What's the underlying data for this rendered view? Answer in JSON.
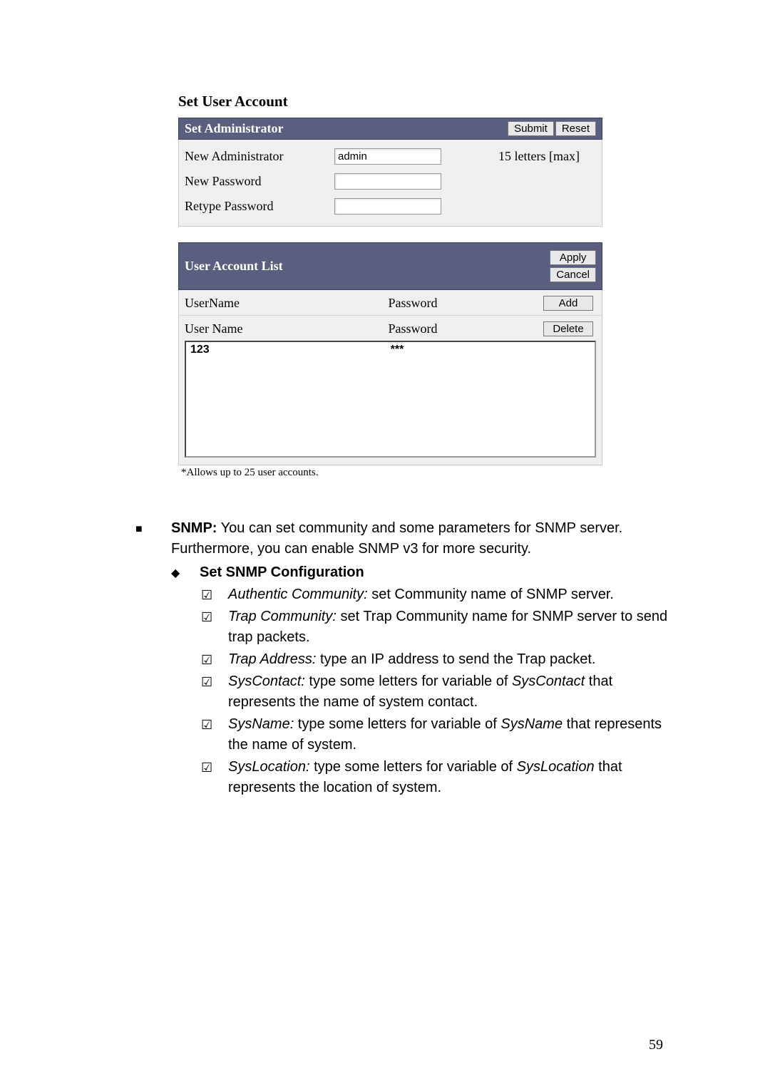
{
  "screenshot": {
    "title": "Set User Account",
    "admin_panel": {
      "header": "Set Administrator",
      "submit": "Submit",
      "reset": "Reset",
      "rows": {
        "new_admin_label": "New Administrator",
        "new_admin_value": "admin",
        "new_admin_hint": "15 letters [max]",
        "new_pw_label": "New Password",
        "retype_pw_label": "Retype Password"
      }
    },
    "user_panel": {
      "header": "User Account List",
      "apply": "Apply",
      "cancel": "Cancel",
      "username_label": "UserName",
      "password_label": "Password",
      "add": "Add",
      "col_user": "User Name",
      "col_pw": "Password",
      "delete": "Delete",
      "list_row_user": "123",
      "list_row_pw": "***",
      "footnote": "*Allows up to 25 user accounts."
    }
  },
  "content": {
    "snmp_label": "SNMP:",
    "snmp_text": " You can set community and some parameters for SNMP server. Furthermore, you can enable SNMP v3 for more security.",
    "set_snmp": "Set SNMP Configuration",
    "items": [
      {
        "term": "Authentic Community:",
        "desc": " set Community name of SNMP server."
      },
      {
        "term": "Trap Community:",
        "desc": " set Trap Community name for SNMP server to send trap packets."
      },
      {
        "term": "Trap Address:",
        "desc": " type an IP address to send the Trap packet."
      },
      {
        "term": "SysContact:",
        "desc_pre": " type some letters for variable of ",
        "desc_ital": "SysContact",
        "desc_post": " that represents the name of system contact."
      },
      {
        "term": "SysName:",
        "desc_pre": " type some letters for variable of ",
        "desc_ital": "SysName",
        "desc_post": " that represents the name of system."
      },
      {
        "term": "SysLocation:",
        "desc_pre": " type some letters for variable of ",
        "desc_ital": "SysLocation",
        "desc_post": " that represents the location of system."
      }
    ]
  },
  "page_number": "59"
}
